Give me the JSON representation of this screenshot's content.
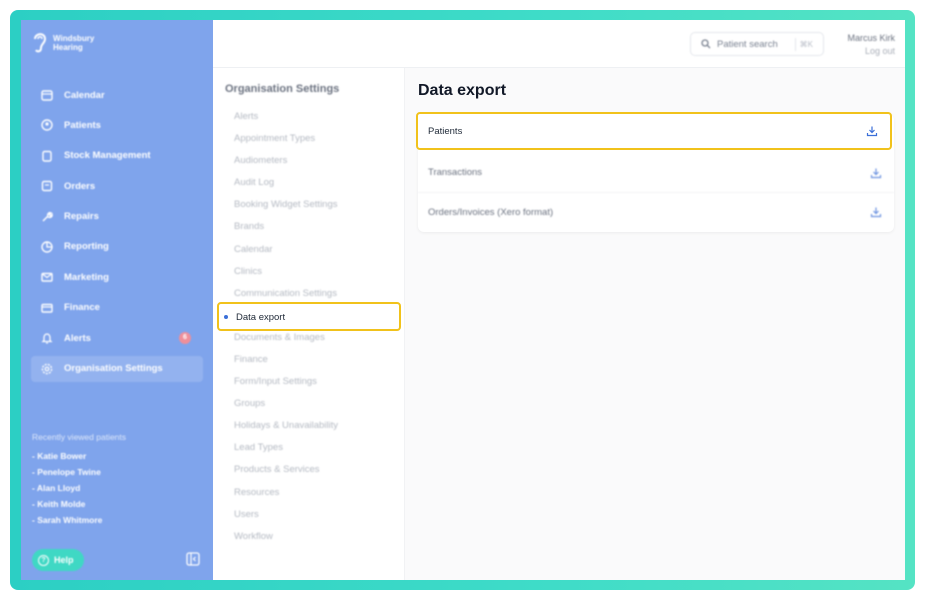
{
  "brand": {
    "line1": "Windsbury",
    "line2": "Hearing"
  },
  "sidebar": {
    "items": [
      {
        "label": "Calendar",
        "icon": "calendar-icon"
      },
      {
        "label": "Patients",
        "icon": "patients-icon"
      },
      {
        "label": "Stock Management",
        "icon": "stock-icon"
      },
      {
        "label": "Orders",
        "icon": "orders-icon"
      },
      {
        "label": "Repairs",
        "icon": "wrench-icon"
      },
      {
        "label": "Reporting",
        "icon": "pie-chart-icon"
      },
      {
        "label": "Marketing",
        "icon": "mail-icon"
      },
      {
        "label": "Finance",
        "icon": "card-icon"
      },
      {
        "label": "Alerts",
        "icon": "bell-icon",
        "badge": "6"
      },
      {
        "label": "Organisation Settings",
        "icon": "gear-icon"
      }
    ],
    "recent_title": "Recently viewed patients",
    "recent": [
      "- Katie Bower",
      "- Penelope Twine",
      "- Alan Lloyd",
      "- Keith Molde",
      "- Sarah Whitmore"
    ],
    "help_label": "Help"
  },
  "header": {
    "search_placeholder": "Patient search",
    "search_shortcut": "⌘K",
    "user_name": "Marcus Kirk",
    "logout_label": "Log out"
  },
  "subnav": {
    "title": "Organisation Settings",
    "items": [
      "Alerts",
      "Appointment Types",
      "Audiometers",
      "Audit Log",
      "Booking Widget Settings",
      "Brands",
      "Calendar",
      "Clinics",
      "Communication Settings",
      "Data export",
      "Documents & Images",
      "Finance",
      "Form/Input Settings",
      "Groups",
      "Holidays & Unavailability",
      "Lead Types",
      "Products & Services",
      "Resources",
      "Users",
      "Workflow"
    ]
  },
  "main": {
    "title": "Data export",
    "exports": [
      "Patients",
      "Transactions",
      "Orders/Invoices (Xero format)"
    ]
  },
  "colors": {
    "sidebar": "#7fa4ec",
    "frame": "#3fdcc8",
    "highlight": "#f1c21b",
    "accent": "#3b6fd8"
  }
}
